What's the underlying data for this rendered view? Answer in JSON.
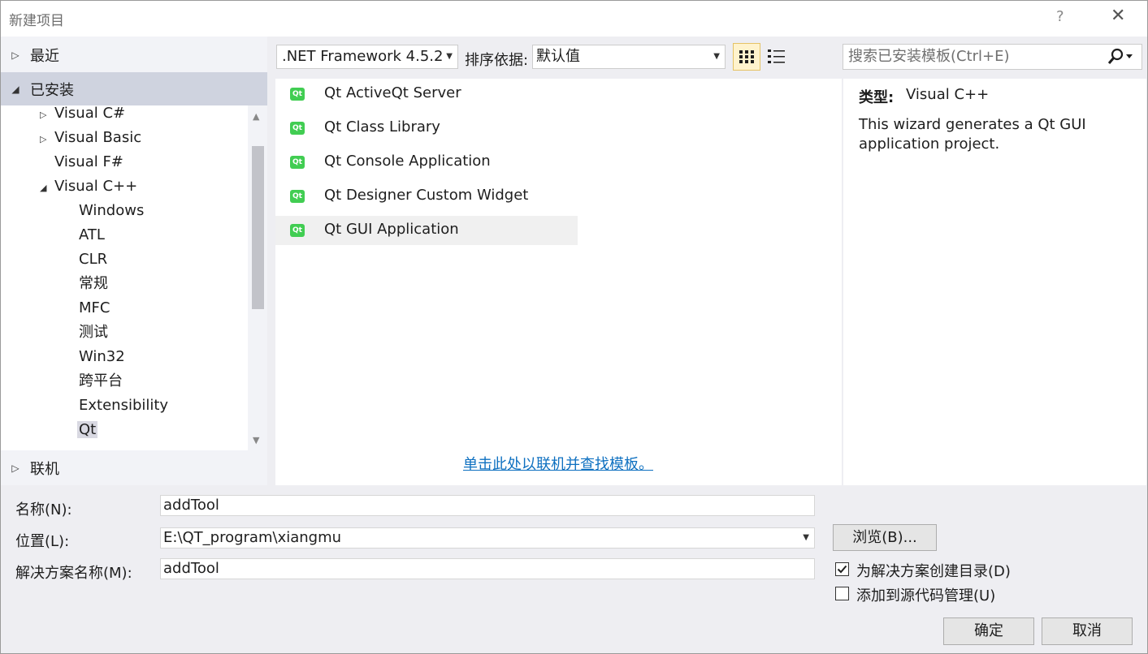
{
  "window": {
    "title": "新建项目",
    "help": "?",
    "close": "✕"
  },
  "nav": {
    "recent": "最近",
    "installed": "已安装",
    "online": "联机",
    "tree": [
      {
        "label": "Visual C#",
        "twisty": "▷"
      },
      {
        "label": "Visual Basic",
        "twisty": "▷"
      },
      {
        "label": "Visual F#",
        "twisty": ""
      },
      {
        "label": "Visual C++",
        "twisty": "◢"
      },
      {
        "label": "Windows"
      },
      {
        "label": "ATL"
      },
      {
        "label": "CLR"
      },
      {
        "label": "常规"
      },
      {
        "label": "MFC"
      },
      {
        "label": "测试"
      },
      {
        "label": "Win32"
      },
      {
        "label": "跨平台"
      },
      {
        "label": "Extensibility"
      },
      {
        "label": "Qt"
      }
    ]
  },
  "toolbar": {
    "framework": ".NET Framework 4.5.2",
    "sort_label": "排序依据:",
    "sort_value": "默认值",
    "search_placeholder": "搜索已安装模板(Ctrl+E)"
  },
  "templates": [
    {
      "icon": "Qt",
      "label": "Qt ActiveQt Server"
    },
    {
      "icon": "Qt",
      "label": "Qt Class Library"
    },
    {
      "icon": "Qt",
      "label": "Qt Console Application"
    },
    {
      "icon": "Qt",
      "label": "Qt Designer Custom Widget"
    },
    {
      "icon": "Qt",
      "label": "Qt GUI Application"
    }
  ],
  "online_link": "单击此处以联机并查找模板。",
  "details": {
    "type_label": "类型:",
    "type_value": "Visual C++",
    "description": "This wizard generates a Qt GUI application project."
  },
  "form": {
    "name_label": "名称(N):",
    "name_value": "addTool",
    "location_label": "位置(L):",
    "location_value": "E:\\QT_program\\xiangmu",
    "solution_label": "解决方案名称(M):",
    "solution_value": "addTool",
    "browse": "浏览(B)...",
    "create_dir_label": "为解决方案创建目录(D)",
    "create_dir_checked": true,
    "add_scm_label": "添加到源代码管理(U)",
    "add_scm_checked": false,
    "ok": "确定",
    "cancel": "取消"
  }
}
